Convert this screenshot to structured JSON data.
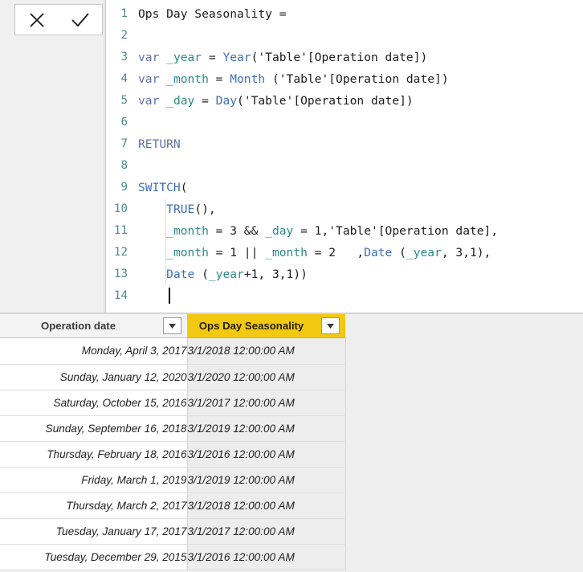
{
  "editor": {
    "commit_buttons": [
      {
        "name": "cancel",
        "label": "✕",
        "icon": "close-icon"
      },
      {
        "name": "accept",
        "label": "✓",
        "icon": "check-icon"
      }
    ],
    "line_count": 14,
    "caret_line": 14,
    "lines": [
      {
        "n": "1",
        "tokens": [
          {
            "t": "plain",
            "s": "Ops Day Seasonality ="
          }
        ]
      },
      {
        "n": "2",
        "tokens": []
      },
      {
        "n": "3",
        "tokens": [
          {
            "t": "kw",
            "s": "var"
          },
          {
            "t": "plain",
            "s": " "
          },
          {
            "t": "varname",
            "s": "_year"
          },
          {
            "t": "plain",
            "s": " = "
          },
          {
            "t": "fn",
            "s": "Year"
          },
          {
            "t": "plain",
            "s": "('Table'[Operation date])"
          }
        ]
      },
      {
        "n": "4",
        "tokens": [
          {
            "t": "kw",
            "s": "var"
          },
          {
            "t": "plain",
            "s": " "
          },
          {
            "t": "varname",
            "s": "_month"
          },
          {
            "t": "plain",
            "s": " = "
          },
          {
            "t": "fn",
            "s": "Month"
          },
          {
            "t": "plain",
            "s": " ('Table'[Operation date])"
          }
        ]
      },
      {
        "n": "5",
        "tokens": [
          {
            "t": "kw",
            "s": "var"
          },
          {
            "t": "plain",
            "s": " "
          },
          {
            "t": "varname",
            "s": "_day"
          },
          {
            "t": "plain",
            "s": " = "
          },
          {
            "t": "fn",
            "s": "Day"
          },
          {
            "t": "plain",
            "s": "('Table'[Operation date])"
          }
        ]
      },
      {
        "n": "6",
        "tokens": []
      },
      {
        "n": "7",
        "tokens": [
          {
            "t": "kw",
            "s": "RETURN"
          }
        ]
      },
      {
        "n": "8",
        "tokens": []
      },
      {
        "n": "9",
        "tokens": [
          {
            "t": "fn",
            "s": "SWITCH"
          },
          {
            "t": "plain",
            "s": "("
          }
        ]
      },
      {
        "n": "10",
        "tokens": [
          {
            "t": "plain",
            "s": "    "
          },
          {
            "t": "fn",
            "s": "TRUE"
          },
          {
            "t": "plain",
            "s": "(),"
          }
        ]
      },
      {
        "n": "11",
        "tokens": [
          {
            "t": "plain",
            "s": "    "
          },
          {
            "t": "varname",
            "s": "_month"
          },
          {
            "t": "plain",
            "s": " = 3 && "
          },
          {
            "t": "varname",
            "s": "_day"
          },
          {
            "t": "plain",
            "s": " = 1,'Table'[Operation date],"
          }
        ]
      },
      {
        "n": "12",
        "tokens": [
          {
            "t": "plain",
            "s": "    "
          },
          {
            "t": "varname",
            "s": "_month"
          },
          {
            "t": "plain",
            "s": " = 1 || "
          },
          {
            "t": "varname",
            "s": "_month"
          },
          {
            "t": "plain",
            "s": " = 2   ,"
          },
          {
            "t": "fn",
            "s": "Date"
          },
          {
            "t": "plain",
            "s": " ("
          },
          {
            "t": "varname",
            "s": "_year"
          },
          {
            "t": "plain",
            "s": ", 3,1),"
          }
        ]
      },
      {
        "n": "13",
        "tokens": [
          {
            "t": "plain",
            "s": "    "
          },
          {
            "t": "fn",
            "s": "Date"
          },
          {
            "t": "plain",
            "s": " ("
          },
          {
            "t": "varname",
            "s": "_year"
          },
          {
            "t": "plain",
            "s": "+1, 3,1))"
          }
        ]
      },
      {
        "n": "14",
        "tokens": []
      }
    ]
  },
  "table": {
    "columns": [
      {
        "label": "Operation date",
        "highlighted": false,
        "filter_icon": "chevron-down-icon"
      },
      {
        "label": "Ops Day Seasonality",
        "highlighted": true,
        "filter_icon": "chevron-down-icon"
      }
    ],
    "rows": [
      {
        "operation_date": "Monday, April 3, 2017",
        "ops_day_seasonality": "3/1/2018 12:00:00 AM"
      },
      {
        "operation_date": "Sunday, January 12, 2020",
        "ops_day_seasonality": "3/1/2020 12:00:00 AM"
      },
      {
        "operation_date": "Saturday, October 15, 2016",
        "ops_day_seasonality": "3/1/2017 12:00:00 AM"
      },
      {
        "operation_date": "Sunday, September 16, 2018",
        "ops_day_seasonality": "3/1/2019 12:00:00 AM"
      },
      {
        "operation_date": "Thursday, February 18, 2016",
        "ops_day_seasonality": "3/1/2016 12:00:00 AM"
      },
      {
        "operation_date": "Friday, March 1, 2019",
        "ops_day_seasonality": "3/1/2019 12:00:00 AM"
      },
      {
        "operation_date": "Thursday, March 2, 2017",
        "ops_day_seasonality": "3/1/2018 12:00:00 AM"
      },
      {
        "operation_date": "Tuesday, January 17, 2017",
        "ops_day_seasonality": "3/1/2017 12:00:00 AM"
      },
      {
        "operation_date": "Tuesday, December 29, 2015",
        "ops_day_seasonality": "3/1/2016 12:00:00 AM"
      }
    ]
  },
  "colors": {
    "accent_gold": "#f2c811",
    "keyword": "#5f6fa8",
    "function": "#3f6fb5",
    "variable": "#2b8a8a",
    "line_number": "#4f8a90",
    "panel_bg": "#f0f0f0",
    "editor_bg": "#ffffff"
  }
}
